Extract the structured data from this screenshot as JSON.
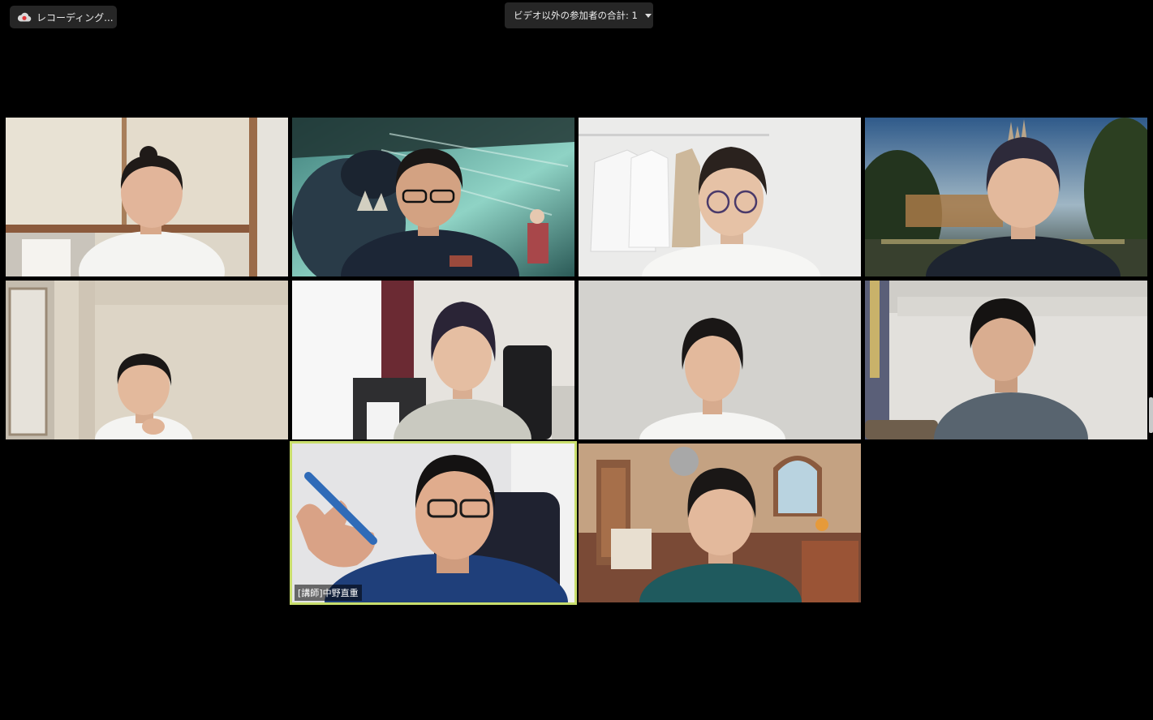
{
  "recording": {
    "label": "レコーディング...",
    "icon": "cloud-record-icon"
  },
  "participants_summary": {
    "label": "ビデオ以外の参加者の合計: 1",
    "icon": "chevron-down-icon"
  },
  "active_speaker": {
    "name_label": "[講師]中野直重"
  },
  "colors": {
    "active_border": "#c9de6c",
    "background": "#000000",
    "chip": "#262626"
  }
}
